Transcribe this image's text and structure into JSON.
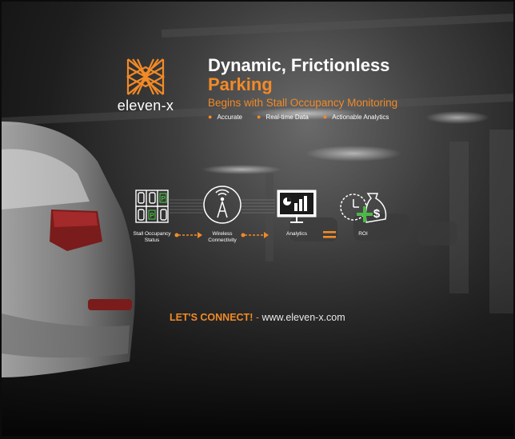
{
  "brand": {
    "name": "eleven-x",
    "accent": "#f28a27"
  },
  "headline": {
    "line1": "Dynamic, Frictionless",
    "line2": "Parking",
    "subtitle": "Begins with Stall Occupancy Monitoring",
    "bullets": [
      "Accurate",
      "Real-time Data",
      "Actionable Analytics"
    ]
  },
  "flow": {
    "steps": [
      {
        "label_line1": "Stall Occupancy",
        "label_line2": "Status",
        "icon": "parking-stalls-icon"
      },
      {
        "label_line1": "Wireless",
        "label_line2": "Connectivity",
        "icon": "wireless-tower-icon"
      },
      {
        "label_line1": "Analytics",
        "label_line2": "",
        "icon": "analytics-monitor-icon"
      },
      {
        "label_line1": "ROI",
        "label_line2": "",
        "icon": "clock-money-icon"
      }
    ],
    "parking_sign": "P",
    "money_sign": "$"
  },
  "cta": {
    "bold": "LET'S CONNECT!",
    "separator": " - ",
    "url": "www.eleven-x.com"
  }
}
